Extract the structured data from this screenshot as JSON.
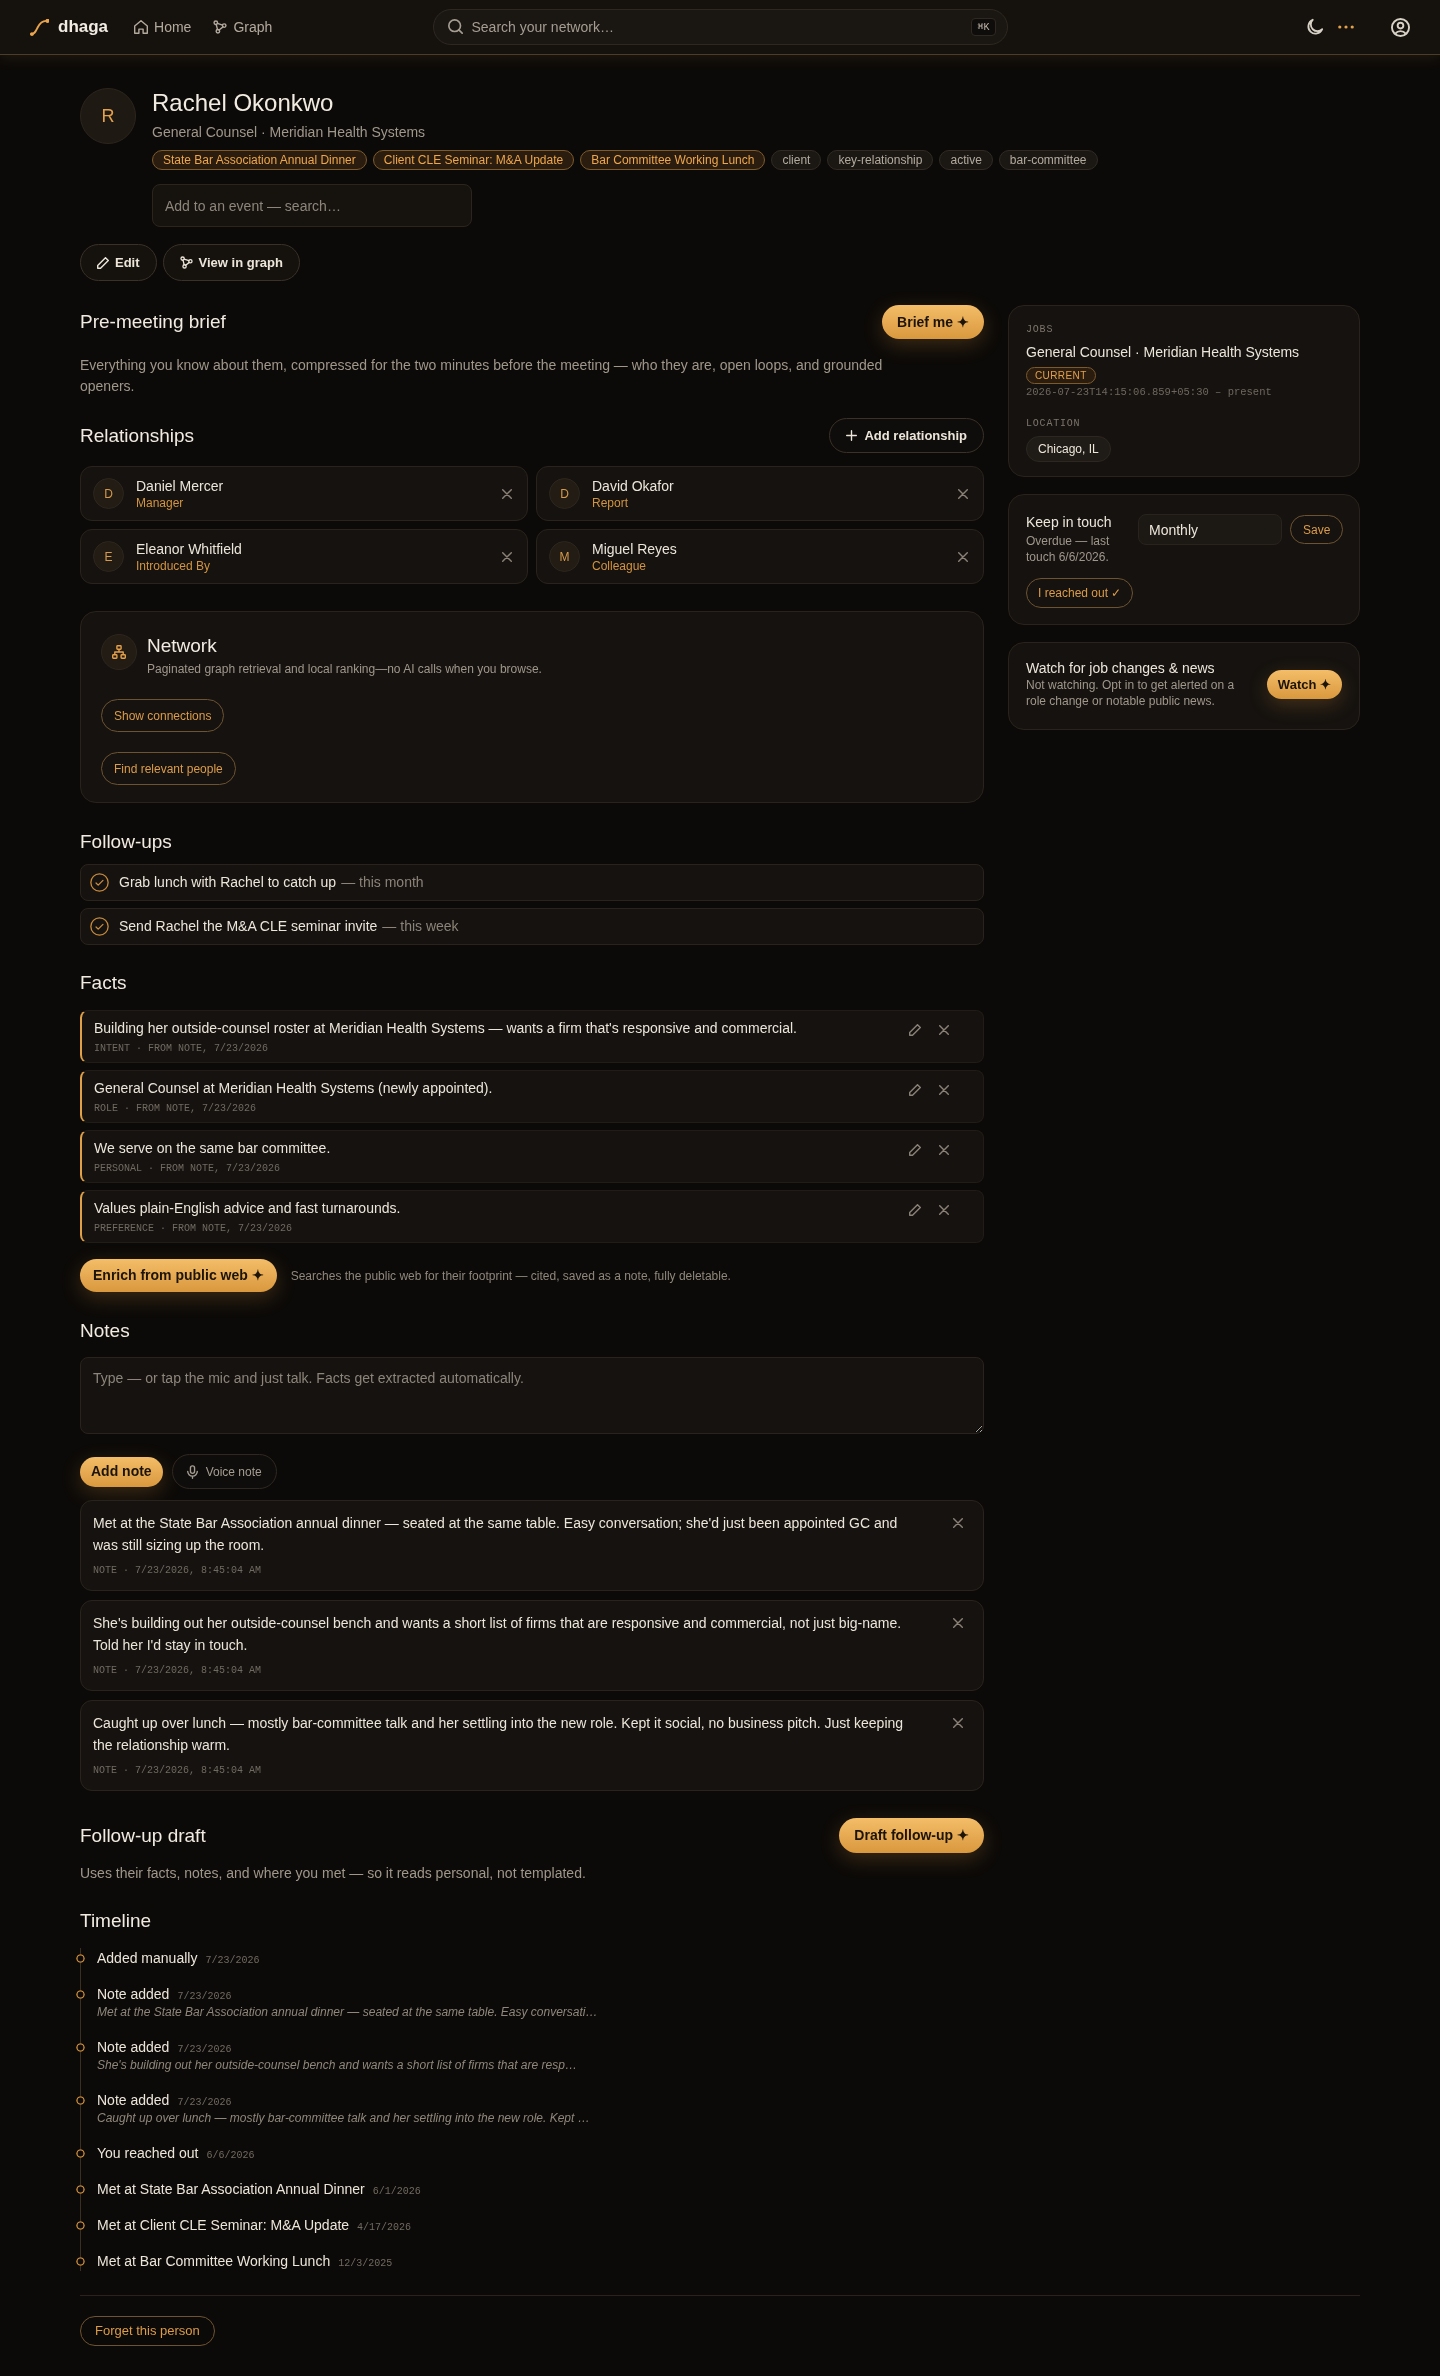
{
  "nav": {
    "brand": "dhaga",
    "links": [
      {
        "label": "Home"
      },
      {
        "label": "Graph"
      }
    ],
    "search": {
      "placeholder": "Search your network…",
      "shortcut": "⌘K"
    }
  },
  "profile": {
    "initial": "R",
    "name": "Rachel Okonkwo",
    "subtitle": "General Counsel · Meridian Health Systems",
    "tags": [
      {
        "label": "State Bar Association Annual Dinner",
        "kind": "event"
      },
      {
        "label": "Client CLE Seminar: M&A Update",
        "kind": "event"
      },
      {
        "label": "Bar Committee Working Lunch",
        "kind": "event"
      },
      {
        "label": "client",
        "kind": "tag"
      },
      {
        "label": "key-relationship",
        "kind": "tag"
      },
      {
        "label": "active",
        "kind": "tag"
      },
      {
        "label": "bar-committee",
        "kind": "tag"
      }
    ],
    "event_search": {
      "placeholder": "Add to an event — search…"
    },
    "actions": [
      {
        "label": "Edit"
      },
      {
        "label": "View in graph"
      }
    ]
  },
  "brief": {
    "title": "Pre-meeting brief",
    "button": "Brief me ✦",
    "description": "Everything you know about them, compressed for the two minutes before the meeting — who they are, open loops, and grounded openers."
  },
  "relationships": {
    "title": "Relationships",
    "add_button": "Add relationship",
    "items": [
      {
        "initial": "D",
        "name": "Daniel Mercer",
        "role": "Manager"
      },
      {
        "initial": "D",
        "name": "David Okafor",
        "role": "Report"
      },
      {
        "initial": "E",
        "name": "Eleanor Whitfield",
        "role": "Introduced By"
      },
      {
        "initial": "M",
        "name": "Miguel Reyes",
        "role": "Colleague"
      }
    ]
  },
  "network": {
    "title": "Network",
    "description": "Paginated graph retrieval and local ranking—no AI calls when you browse.",
    "buttons": [
      "Show connections",
      "Find relevant people"
    ]
  },
  "followups": {
    "title": "Follow-ups",
    "items": [
      {
        "text": "Grab lunch with Rachel to catch up",
        "due": "— this month"
      },
      {
        "text": "Send Rachel the M&A CLE seminar invite",
        "due": "— this week"
      }
    ]
  },
  "facts": {
    "title": "Facts",
    "items": [
      {
        "text": "Building her outside-counsel roster at Meridian Health Systems — wants a firm that's responsive and commercial.",
        "meta": "INTENT · FROM NOTE, 7/23/2026"
      },
      {
        "text": "General Counsel at Meridian Health Systems (newly appointed).",
        "meta": "ROLE · FROM NOTE, 7/23/2026"
      },
      {
        "text": "We serve on the same bar committee.",
        "meta": "PERSONAL · FROM NOTE, 7/23/2026"
      },
      {
        "text": "Values plain-English advice and fast turnarounds.",
        "meta": "PREFERENCE · FROM NOTE, 7/23/2026"
      }
    ],
    "enrich_button": "Enrich from public web ✦",
    "enrich_note": "Searches the public web for their footprint — cited, saved as a note, fully deletable."
  },
  "notes": {
    "title": "Notes",
    "input": {
      "placeholder": "Type — or tap the mic and just talk. Facts get extracted automatically."
    },
    "add_button": "Add note",
    "voice_button": "Voice note",
    "items": [
      {
        "text": "Met at the State Bar Association annual dinner — seated at the same table. Easy conversation; she'd just been appointed GC and was still sizing up the room.",
        "meta": "NOTE · 7/23/2026, 8:45:04 AM"
      },
      {
        "text": "She's building out her outside-counsel bench and wants a short list of firms that are responsive and commercial, not just big-name. Told her I'd stay in touch.",
        "meta": "NOTE · 7/23/2026, 8:45:04 AM"
      },
      {
        "text": "Caught up over lunch — mostly bar-committee talk and her settling into the new role. Kept it social, no business pitch. Just keeping the relationship warm.",
        "meta": "NOTE · 7/23/2026, 8:45:04 AM"
      }
    ]
  },
  "followup_draft": {
    "title": "Follow-up draft",
    "button": "Draft follow-up ✦",
    "description": "Uses their facts, notes, and where you met — so it reads personal, not templated."
  },
  "timeline": {
    "title": "Timeline",
    "items": [
      {
        "title": "Added manually",
        "date": "7/23/2026"
      },
      {
        "title": "Note added",
        "date": "7/23/2026",
        "excerpt": "Met at the State Bar Association annual dinner — seated at the same table. Easy conversati…"
      },
      {
        "title": "Note added",
        "date": "7/23/2026",
        "excerpt": "She's building out her outside-counsel bench and wants a short list of firms that are resp…"
      },
      {
        "title": "Note added",
        "date": "7/23/2026",
        "excerpt": "Caught up over lunch — mostly bar-committee talk and her settling into the new role. Kept …"
      },
      {
        "title": "You reached out",
        "date": "6/6/2026"
      },
      {
        "title": "Met at State Bar Association Annual Dinner",
        "date": "6/1/2026"
      },
      {
        "title": "Met at Client CLE Seminar: M&A Update",
        "date": "4/17/2026"
      },
      {
        "title": "Met at Bar Committee Working Lunch",
        "date": "12/3/2025"
      }
    ]
  },
  "forget_button": "Forget this person",
  "sidebar": {
    "jobs": {
      "label": "JOBS",
      "title": "General Counsel · Meridian Health Systems",
      "badge": "CURRENT",
      "dates": "2026-07-23T14:15:06.859+05:30 – present",
      "location_label": "LOCATION",
      "location": "Chicago, IL"
    },
    "keep_in_touch": {
      "title": "Keep in touch",
      "status": "Overdue — last touch 6/6/2026.",
      "frequency": {
        "value": "Monthly"
      },
      "save_button": "Save",
      "reached_button": "I reached out ✓"
    },
    "watch": {
      "title": "Watch for job changes & news",
      "description": "Not watching. Opt in to get alerted on a role change or notable public news.",
      "button": "Watch ✦"
    }
  }
}
